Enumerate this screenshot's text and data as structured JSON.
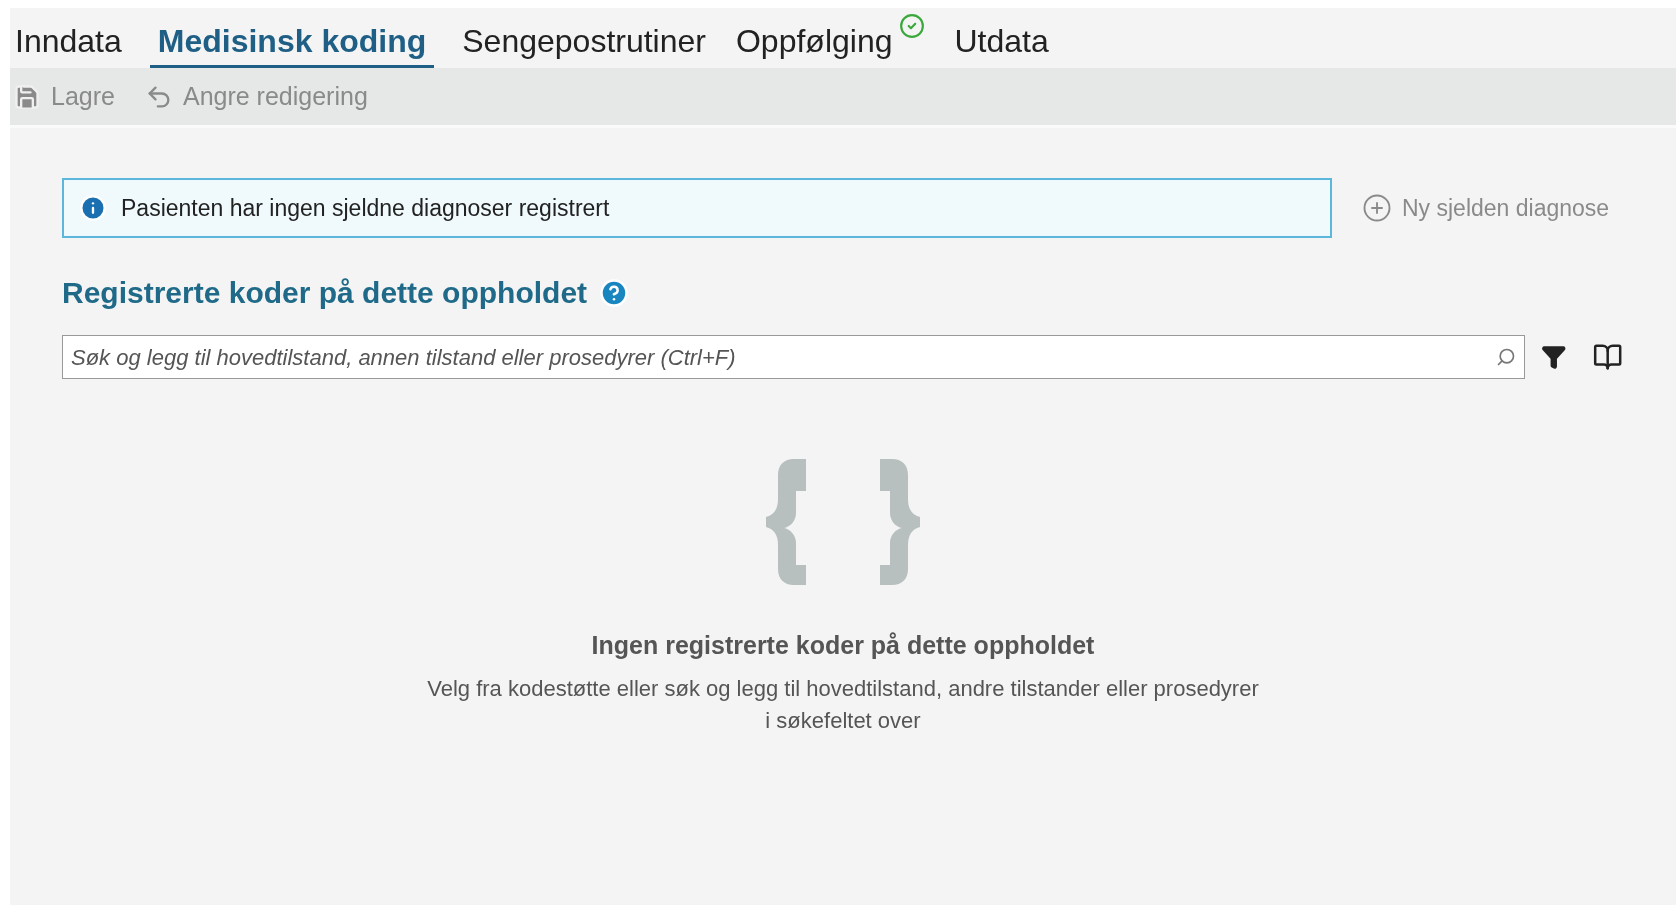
{
  "tabs": [
    {
      "label": "Inndata",
      "selected": false,
      "done": false
    },
    {
      "label": "Medisinsk koding",
      "selected": true,
      "done": false
    },
    {
      "label": "Sengepostrutiner",
      "selected": false,
      "done": false
    },
    {
      "label": "Oppfølging",
      "selected": false,
      "done": true
    },
    {
      "label": "Utdata",
      "selected": false,
      "done": false
    }
  ],
  "toolbar": [
    {
      "kind": "save",
      "label": "Lagre",
      "disabled": true
    },
    {
      "kind": "undo",
      "label": "Angre redigering",
      "disabled": true
    }
  ],
  "info_banner": {
    "text": "Pasienten har ingen sjeldne diagnoser registrert"
  },
  "new_rare_diagnosis": {
    "label": "Ny sjelden diagnose",
    "disabled": true
  },
  "section_title": "Registrerte koder på dette oppholdet",
  "search": {
    "placeholder": "Søk og legg til hovedtilstand, annen tilstand eller prosedyrer (Ctrl+F)"
  },
  "empty_state": {
    "title": "Ingen registrerte koder på dette oppholdet",
    "message": "Velg fra kodestøtte eller søk og legg til hovedtilstand, andre tilstander eller prosedyrer i søkefeltet over"
  }
}
